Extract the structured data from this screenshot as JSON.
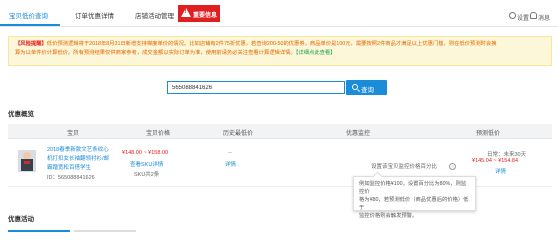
{
  "nav": {
    "tabs": [
      {
        "label": "宝贝低价查询",
        "active": true
      },
      {
        "label": "订单优惠详情"
      },
      {
        "label": "店铺活动管理"
      }
    ],
    "warning_tab": "重要信息",
    "settings": "设置",
    "messages": "消息"
  },
  "notice": {
    "prefix": "【风险提醒】",
    "line1": "低价预测逻辑将于2018年8月31日新增支持梯度单价的情况。比如店铺有2件75折优惠，若查询200-50的优惠券，商品单价是100元，需要按照2件商品才满足以上优惠门槛，则在低价预测时会换",
    "line2": "算为以单件价计算低价。所有预测结果仅供商家参考，成交金额以实际订单为准，使用前请务必关注查看计算逻辑详情。",
    "link": "【详细点此查看】"
  },
  "search": {
    "value": "565088841626",
    "button_label": "查询"
  },
  "sections": {
    "overview": "优惠概览",
    "activity": "优惠活动"
  },
  "table": {
    "headers": [
      "宝贝",
      "宝贝价格",
      "历史最低价",
      "优惠监控",
      "预测低价"
    ],
    "row": {
      "title": [
        "2018春季新款文艺条纹心",
        "机打扣女长袖翻领衬衫/邮",
        "霸蹭宽松百搭学生"
      ],
      "id": "ID：565088841626",
      "price": "¥148.00 ~ ¥158.00",
      "sku_detail": "查看SKU详情",
      "sku_count": "SKU共2条",
      "history_value": "--",
      "history_link": "详情",
      "monitor_label": "设置该宝贝监控价格百分比",
      "predict_label": "日常：未来30天",
      "predict_price": "¥145.04 ~ ¥154.84",
      "predict_link": "详情"
    }
  },
  "tooltip": {
    "line1": "例如监控价格¥100，设置百分比为80%，则监控价",
    "line2": "格为¥80，若预测低价（商品优惠后的价格）低于",
    "line3": "监控价格则会触发预警。"
  },
  "colors": {
    "accent": "#1a8cd8",
    "warning": "#e02020",
    "notice_bg": "#fdf7d9"
  }
}
